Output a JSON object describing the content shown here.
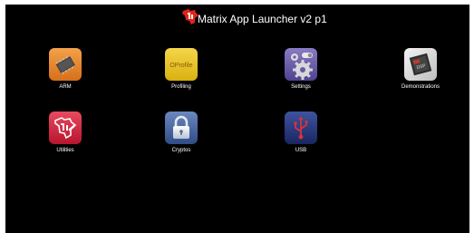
{
  "header": {
    "title": "Matrix App Launcher v2 p1",
    "logo_icon": "ti-logo-icon",
    "logo_color": "#e2231a"
  },
  "apps": [
    {
      "label": "ARM",
      "icon": "chip-icon"
    },
    {
      "label": "Profiling",
      "icon": "profile-icon",
      "icon_text": "OProfile"
    },
    {
      "label": "Settings",
      "icon": "gears-icon"
    },
    {
      "label": "Demonstrations",
      "icon": "demo-chip-icon",
      "icon_text": "DSP"
    },
    {
      "label": "Utilities",
      "icon": "ti-utilities-icon"
    },
    {
      "label": "Cryptos",
      "icon": "padlock-icon"
    },
    {
      "label": "USB",
      "icon": "usb-icon"
    }
  ],
  "colors": {
    "background": "#000000",
    "text": "#ffffff",
    "arm_orange": "#e8892a",
    "profiling_yellow": "#e6c21c",
    "settings_purple": "#6a5aa6",
    "utilities_red": "#d4213c",
    "cryptos_blue": "#3f5f9a",
    "usb_navy": "#2a3a7a"
  }
}
